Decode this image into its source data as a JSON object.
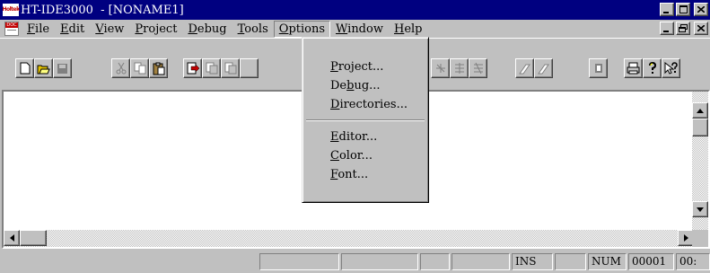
{
  "window": {
    "logo_text": "Holtek",
    "title": "HT-IDE3000  - [NONAME1]",
    "controls": [
      "minimize",
      "maximize",
      "close"
    ]
  },
  "menubar": {
    "doc_icon": "doc-icon",
    "items": [
      {
        "label": "File"
      },
      {
        "label": "Edit"
      },
      {
        "label": "View"
      },
      {
        "label": "Project"
      },
      {
        "label": "Debug"
      },
      {
        "label": "Tools"
      },
      {
        "label": "Options",
        "active": true
      },
      {
        "label": "Window"
      },
      {
        "label": "Help"
      }
    ]
  },
  "toolbar": {
    "buttons": [
      "new-file",
      "open-folder",
      "save",
      "cut",
      "copy",
      "paste",
      "build",
      "step-into",
      "step-over",
      "step-out",
      "breakpoint",
      "run",
      "reset",
      "print",
      "help",
      "context-help"
    ]
  },
  "options_menu": {
    "items": [
      {
        "label": "Project...",
        "accel": "P"
      },
      {
        "label": "Debug...",
        "accel": "b"
      },
      {
        "label": "Directories...",
        "accel": "D"
      },
      {
        "separator": true
      },
      {
        "label": "Editor...",
        "accel": "E"
      },
      {
        "label": "Color...",
        "accel": "C"
      },
      {
        "label": "Font...",
        "accel": "F"
      }
    ]
  },
  "statusbar": {
    "ins": "INS",
    "num": "NUM",
    "line": "00001",
    "col": "00:"
  },
  "colors": {
    "titlebar": "#000080",
    "face": "#c0c0c0"
  }
}
